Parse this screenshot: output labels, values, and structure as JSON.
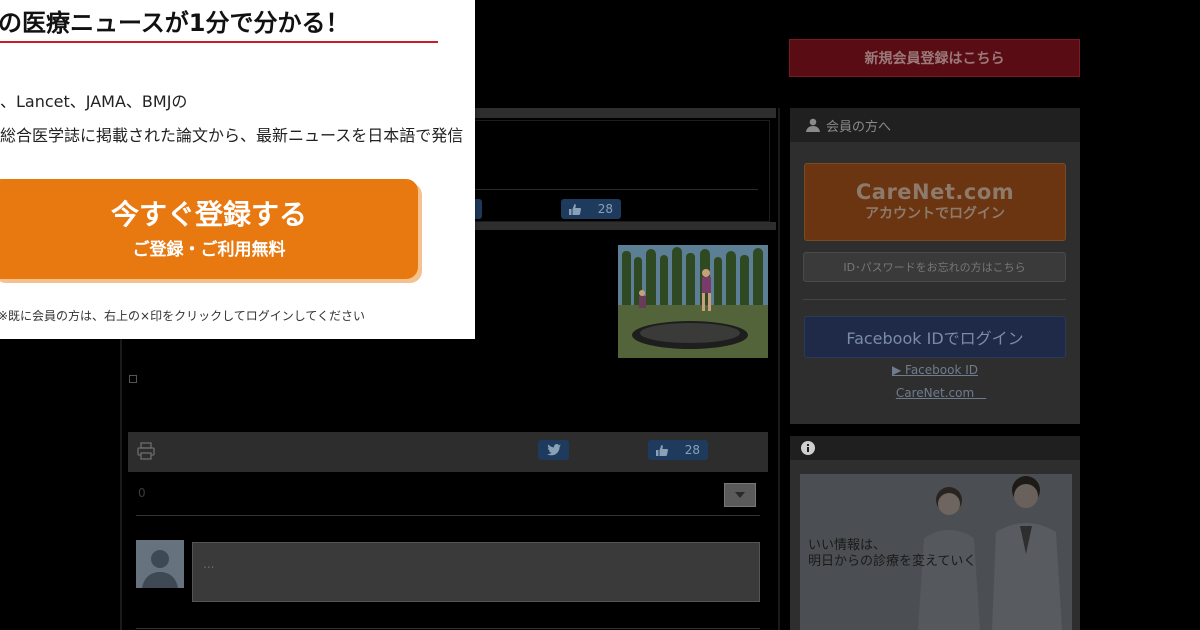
{
  "modal": {
    "title": "の医療ニュースが1分で分かる！",
    "line1": "、Lancet、JAMA、BMJの",
    "line2": "総合医学誌に掲載された論文から、最新ニュースを日本語で発信",
    "cta_main": "今すぐ登録する",
    "cta_sub": "ご登録・ご利用無料",
    "note": "※既に会員の方は、右上の×印をクリックしてログインしてください"
  },
  "article": {
    "like_count_1": "28",
    "like_count_2": "28",
    "comment_count": "0",
    "comment_placeholder": "..."
  },
  "sidebar": {
    "register_label": "新規会員登録はこちら",
    "member_header": "会員の方へ",
    "carenet_line1": "CareNet.com",
    "carenet_line2": "アカウントでログイン",
    "forgot_label": "ID･パスワードをお忘れの方はこちら",
    "facebook_login": "Facebook IDでログイン",
    "fb_link1": "▶ Facebook ID",
    "fb_link2": "CareNet.com　",
    "info_text_line1": "いい情報は、",
    "info_text_line2": "明日からの診療を変えていく"
  },
  "colors": {
    "accent_orange": "#e87810",
    "accent_red": "#c81e2c"
  }
}
